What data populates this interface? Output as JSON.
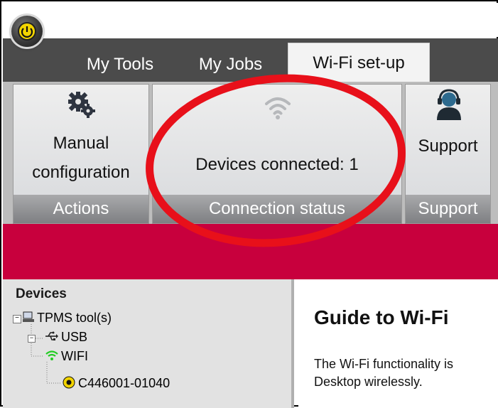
{
  "tabs": [
    {
      "label": "My Tools"
    },
    {
      "label": "My Jobs"
    },
    {
      "label": "Wi-Fi set-up"
    }
  ],
  "ribbon": {
    "actions": {
      "button_line1": "Manual",
      "button_line2": "configuration",
      "group_label": "Actions"
    },
    "connection": {
      "status_text": "Devices connected: 1",
      "group_label": "Connection status"
    },
    "support": {
      "button_label": "Support",
      "group_label": "Support"
    }
  },
  "devices": {
    "title": "Devices",
    "tree": {
      "root": "TPMS tool(s)",
      "usb": "USB",
      "wifi": "WIFI",
      "device": "C446001-01040"
    }
  },
  "guide": {
    "title": "Guide to Wi-Fi",
    "line1": "The Wi-Fi functionality is",
    "line2": "Desktop wirelessly."
  },
  "colors": {
    "banner": "#c8003d",
    "wifi_icon": "#22cc22",
    "annotation": "#e8101a",
    "orb": "#f2d400"
  },
  "icons": {
    "settings": "gears-icon",
    "wifi": "wifi-icon",
    "support": "headset-icon",
    "usb": "usb-icon",
    "tool": "tpms-tool-icon"
  }
}
